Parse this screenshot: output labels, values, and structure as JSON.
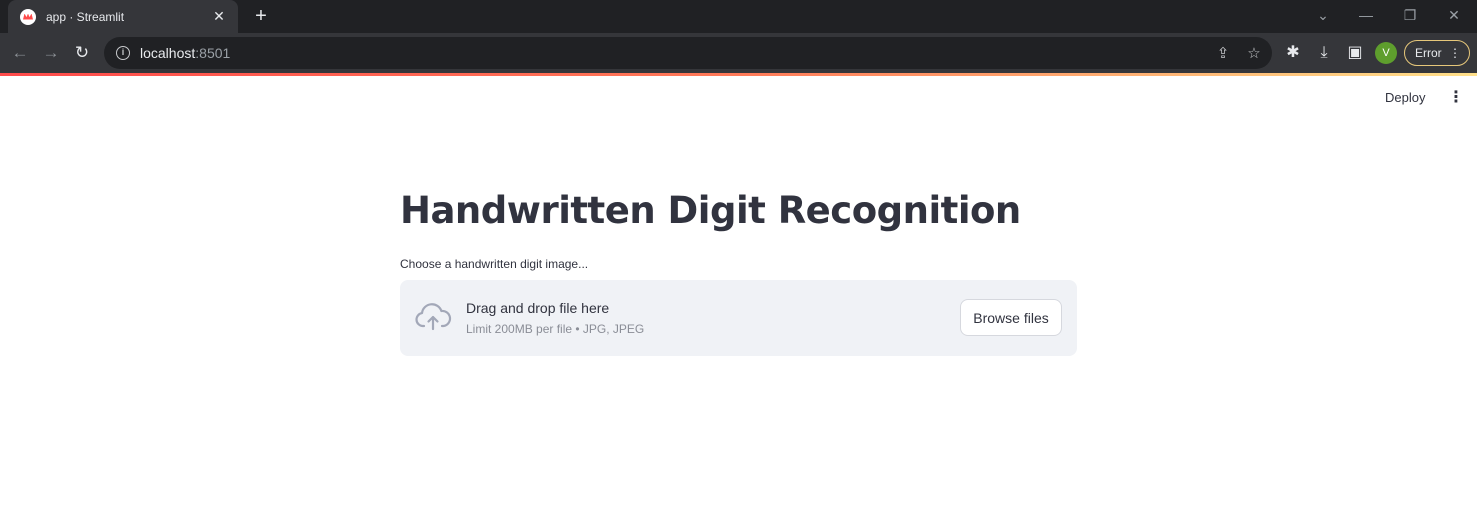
{
  "browser": {
    "tab": {
      "title": "app · Streamlit",
      "favicon": "streamlit-crown-icon",
      "close": "✕"
    },
    "new_tab": "+",
    "window_controls": {
      "minimize": "—",
      "restore": "❐",
      "close": "✕",
      "tab_search": "⌄"
    },
    "address": {
      "host": "localhost",
      "port": ":8501"
    },
    "profile_initial": "V",
    "status_label": "Error",
    "accent_color": "#ff4b4b"
  },
  "app": {
    "deploy_label": "Deploy",
    "menu_icon": "⋮",
    "title": "Handwritten Digit Recognition",
    "uploader": {
      "label": "Choose a handwritten digit image...",
      "drag_text": "Drag and drop file here",
      "limit_text": "Limit 200MB per file • JPG, JPEG",
      "button_label": "Browse files"
    }
  }
}
